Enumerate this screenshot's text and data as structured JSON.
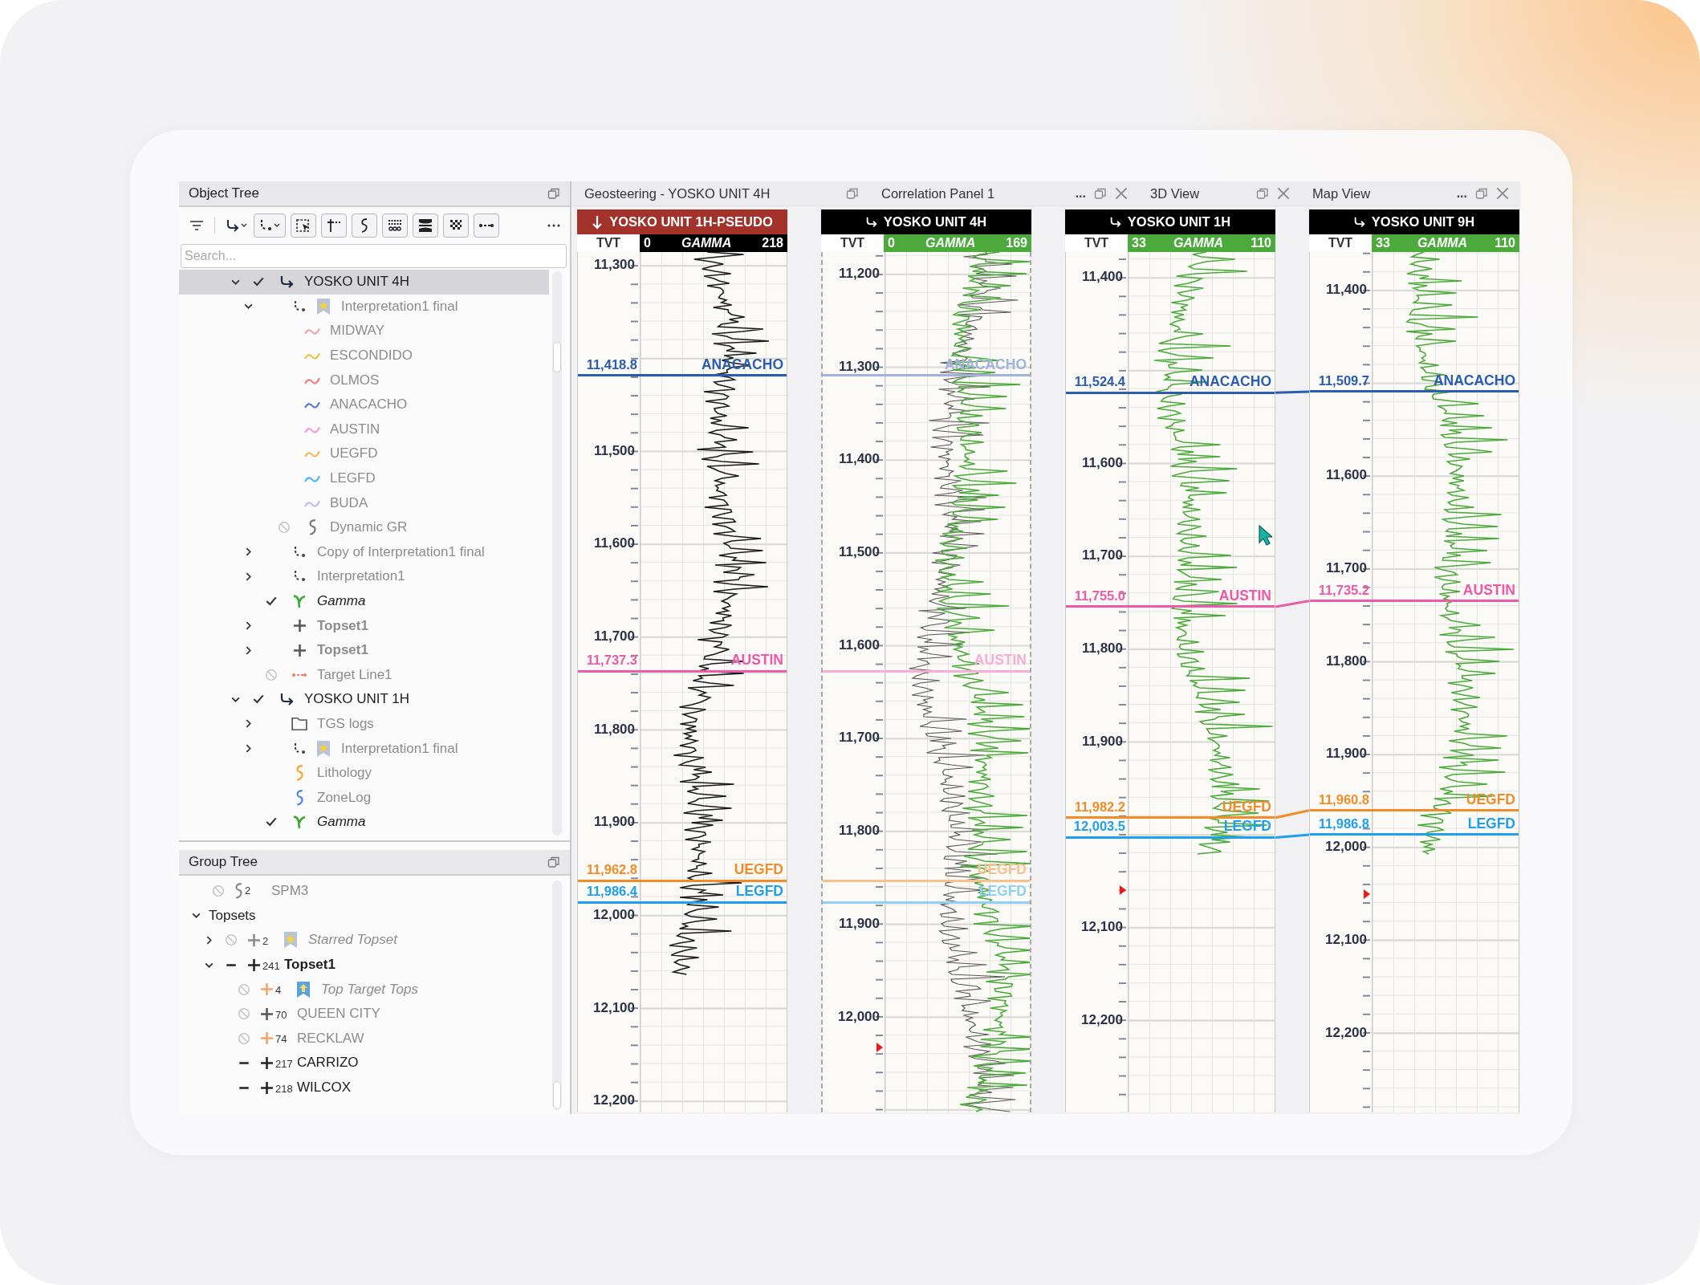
{
  "object_tree": {
    "title": "Object Tree",
    "search": {
      "placeholder": "Search..."
    },
    "items": [
      {
        "label": "YOSKO UNIT 4H",
        "kind": "well",
        "expanded": true,
        "checked": true,
        "dim": false,
        "bold": false,
        "italic": false,
        "selected": true,
        "children": [
          {
            "label": "Interpretation1 final",
            "kind": "interp",
            "starred": true,
            "expanded": true,
            "dim": true,
            "bold": false,
            "italic": false,
            "selected": false,
            "children": [
              {
                "label": "MIDWAY",
                "kind": "horizon",
                "color": "#f5a3ac",
                "dim": true,
                "bold": false,
                "italic": false,
                "selected": false
              },
              {
                "label": "ESCONDIDO",
                "kind": "horizon",
                "color": "#e8c44c",
                "dim": true,
                "bold": false,
                "italic": false,
                "selected": false
              },
              {
                "label": "OLMOS",
                "kind": "horizon",
                "color": "#f07c80",
                "dim": true,
                "bold": false,
                "italic": false,
                "selected": false
              },
              {
                "label": "ANACACHO",
                "kind": "horizon",
                "color": "#5b80c2",
                "dim": true,
                "bold": false,
                "italic": false,
                "selected": false
              },
              {
                "label": "AUSTIN",
                "kind": "horizon",
                "color": "#f59bd2",
                "dim": true,
                "bold": false,
                "italic": false,
                "selected": false
              },
              {
                "label": "UEGFD",
                "kind": "horizon",
                "color": "#f6b862",
                "dim": true,
                "bold": false,
                "italic": false,
                "selected": false
              },
              {
                "label": "LEGFD",
                "kind": "horizon",
                "color": "#4cb8f2",
                "dim": true,
                "bold": false,
                "italic": false,
                "selected": false
              },
              {
                "label": "BUDA",
                "kind": "horizon",
                "color": "#c3bbf2",
                "dim": true,
                "bold": false,
                "italic": false,
                "selected": false
              },
              {
                "label": "Dynamic GR",
                "kind": "log",
                "color": "#7a7a7a",
                "checked": false,
                "dim": true,
                "bold": false,
                "italic": false,
                "selected": false
              }
            ]
          },
          {
            "label": "Copy of Interpretation1 final",
            "kind": "interp",
            "expanded": false,
            "dim": true,
            "bold": false,
            "italic": false,
            "selected": false
          },
          {
            "label": "Interpretation1",
            "kind": "interp",
            "expanded": false,
            "dim": true,
            "bold": false,
            "italic": false,
            "selected": false
          },
          {
            "label": "Gamma",
            "kind": "gamma",
            "checked": true,
            "dim": false,
            "bold": false,
            "italic": true,
            "selected": false
          },
          {
            "label": "Topset1",
            "kind": "topset",
            "color": "#555555",
            "expanded": false,
            "dim": true,
            "bold": true,
            "italic": false,
            "selected": false
          },
          {
            "label": "Topset1",
            "kind": "topset",
            "color": "#555555",
            "expanded": false,
            "dim": true,
            "bold": true,
            "italic": false,
            "selected": false
          },
          {
            "label": "Target Line1",
            "kind": "target",
            "checked": false,
            "dim": true,
            "bold": false,
            "italic": false,
            "selected": false
          }
        ]
      },
      {
        "label": "YOSKO UNIT 1H",
        "kind": "well",
        "expanded": true,
        "checked": true,
        "dim": false,
        "bold": false,
        "italic": false,
        "selected": false,
        "children": [
          {
            "label": "TGS logs",
            "kind": "folder",
            "expanded": false,
            "dim": true,
            "bold": false,
            "italic": false,
            "selected": false
          },
          {
            "label": "Interpretation1 final",
            "kind": "interp",
            "starred": true,
            "expanded": false,
            "dim": true,
            "bold": false,
            "italic": false,
            "selected": false
          },
          {
            "label": "Lithology",
            "kind": "log",
            "color": "#f5a623",
            "dim": true,
            "bold": false,
            "italic": false,
            "selected": false
          },
          {
            "label": "ZoneLog",
            "kind": "log",
            "color": "#4a86e8",
            "dim": true,
            "bold": false,
            "italic": false,
            "selected": false
          },
          {
            "label": "Gamma",
            "kind": "gamma",
            "checked": true,
            "dim": false,
            "bold": false,
            "italic": true,
            "selected": false
          }
        ]
      }
    ]
  },
  "group_tree": {
    "title": "Group Tree",
    "items": [
      {
        "label": "SPM3",
        "kind": "log",
        "color": "#8a8a8a",
        "count": "2",
        "checked": false,
        "dim": true,
        "bold": false,
        "italic": false
      },
      {
        "label": "Topsets",
        "kind": "group",
        "expanded": true,
        "dim": false,
        "bold": false,
        "italic": false,
        "children": [
          {
            "label": "Starred Topset",
            "kind": "topset",
            "color": "#8a8a8a",
            "count": "2",
            "starred": true,
            "expanded": false,
            "checked": false,
            "dim": true,
            "bold": false,
            "italic": true
          },
          {
            "label": "Topset1",
            "kind": "topset",
            "color": "#222222",
            "count": "241",
            "expanded": true,
            "partial": true,
            "dim": false,
            "bold": true,
            "italic": false,
            "children": [
              {
                "label": "Top Target Tops",
                "kind": "topset",
                "color": "#f2a566",
                "count": "4",
                "marked": true,
                "checked": false,
                "dim": true,
                "bold": false,
                "italic": true
              },
              {
                "label": "QUEEN CITY",
                "kind": "topset",
                "color": "#555555",
                "count": "70",
                "checked": false,
                "dim": true,
                "bold": false,
                "italic": false
              },
              {
                "label": "RECKLAW",
                "kind": "topset",
                "color": "#f2a566",
                "count": "74",
                "checked": false,
                "dim": true,
                "bold": false,
                "italic": false
              },
              {
                "label": "CARRIZO",
                "kind": "topset",
                "color": "#222222",
                "count": "217",
                "partial": true,
                "dim": false,
                "bold": false,
                "italic": false
              },
              {
                "label": "WILCOX",
                "kind": "topset",
                "color": "#222222",
                "count": "218",
                "partial": true,
                "dim": false,
                "bold": false,
                "italic": false
              }
            ]
          }
        ]
      }
    ]
  },
  "tabs": [
    {
      "title": "Geosteering - YOSKO UNIT 4H",
      "closable": false
    },
    {
      "title": "Correlation Panel 1",
      "overflow": "...",
      "closable": true
    },
    {
      "title": "3D View",
      "closable": true
    },
    {
      "title": "Map View",
      "overflow": "...",
      "closable": true
    }
  ],
  "tracks": [
    {
      "title": "YOSKO UNIT 1H-PSEUDO",
      "kind": "pseudo",
      "selected": false,
      "axis": "TVT",
      "scale": {
        "min": "0",
        "name": "GAMMA",
        "max": "218",
        "color": "#000000"
      },
      "curves": [
        {
          "color": "#1a1a1a"
        }
      ],
      "ticks": [
        "11,300",
        "11,500",
        "11,600",
        "11,700",
        "11,800",
        "11,900",
        "12,000",
        "12,100",
        "12,200"
      ],
      "tops": [
        {
          "name": "ANACACHO",
          "depth": "11,418.8",
          "color": "#2a5cb0"
        },
        {
          "name": "AUSTIN",
          "depth": "11,737.3",
          "color": "#ec5aa8"
        },
        {
          "name": "UEGFD",
          "depth": "11,962.8",
          "color": "#f28c28"
        },
        {
          "name": "LEGFD",
          "depth": "11,986.4",
          "color": "#1e9ff0"
        }
      ]
    },
    {
      "title": "YOSKO UNIT 4H",
      "kind": "well",
      "selected": true,
      "axis": "TVT",
      "scale": {
        "min": "0",
        "name": "GAMMA",
        "max": "169",
        "color": "#4caa3c"
      },
      "curves": [
        {
          "color": "#555555"
        },
        {
          "color": "#4caa3c"
        }
      ],
      "ticks": [
        "11,200",
        "11,300",
        "11,400",
        "11,500",
        "11,600",
        "11,700",
        "11,800",
        "11,900",
        "12,000"
      ],
      "tops": [
        {
          "name": "ANACACHO",
          "color": "#9fb3da"
        },
        {
          "name": "AUSTIN",
          "color": "#f7aed6"
        },
        {
          "name": "UEGFD",
          "color": "#f8c08c"
        },
        {
          "name": "LEGFD",
          "color": "#8ed0f6"
        }
      ]
    },
    {
      "title": "YOSKO UNIT 1H",
      "kind": "well",
      "selected": false,
      "axis": "TVT",
      "scale": {
        "min": "33",
        "name": "GAMMA",
        "max": "110",
        "color": "#4caa3c"
      },
      "curves": [
        {
          "color": "#4caa3c"
        }
      ],
      "ticks": [
        "11,400",
        "11,600",
        "11,700",
        "11,800",
        "11,900",
        "12,100",
        "12,200"
      ],
      "tops": [
        {
          "name": "ANACACHO",
          "depth": "11,524.4",
          "color": "#2a5cb0"
        },
        {
          "name": "AUSTIN",
          "depth": "11,755.0",
          "color": "#ec5aa8"
        },
        {
          "name": "UEGFD",
          "depth": "11,982.2",
          "color": "#f28c28"
        },
        {
          "name": "LEGFD",
          "depth": "12,003.5",
          "color": "#1e9ff0"
        }
      ]
    },
    {
      "title": "YOSKO UNIT 9H",
      "kind": "well",
      "selected": false,
      "axis": "TVT",
      "scale": {
        "min": "33",
        "name": "GAMMA",
        "max": "110",
        "color": "#4caa3c"
      },
      "curves": [
        {
          "color": "#4caa3c"
        }
      ],
      "ticks": [
        "11,400",
        "11,600",
        "11,700",
        "11,800",
        "11,900",
        "12,000",
        "12,100",
        "12,200"
      ],
      "tops": [
        {
          "name": "ANACACHO",
          "depth": "11,509.7",
          "color": "#2a5cb0"
        },
        {
          "name": "AUSTIN",
          "depth": "11,735.2",
          "color": "#ec5aa8"
        },
        {
          "name": "UEGFD",
          "depth": "11,960.8",
          "color": "#f28c28"
        },
        {
          "name": "LEGFD",
          "depth": "11,986.8",
          "color": "#1e9ff0"
        }
      ]
    }
  ]
}
